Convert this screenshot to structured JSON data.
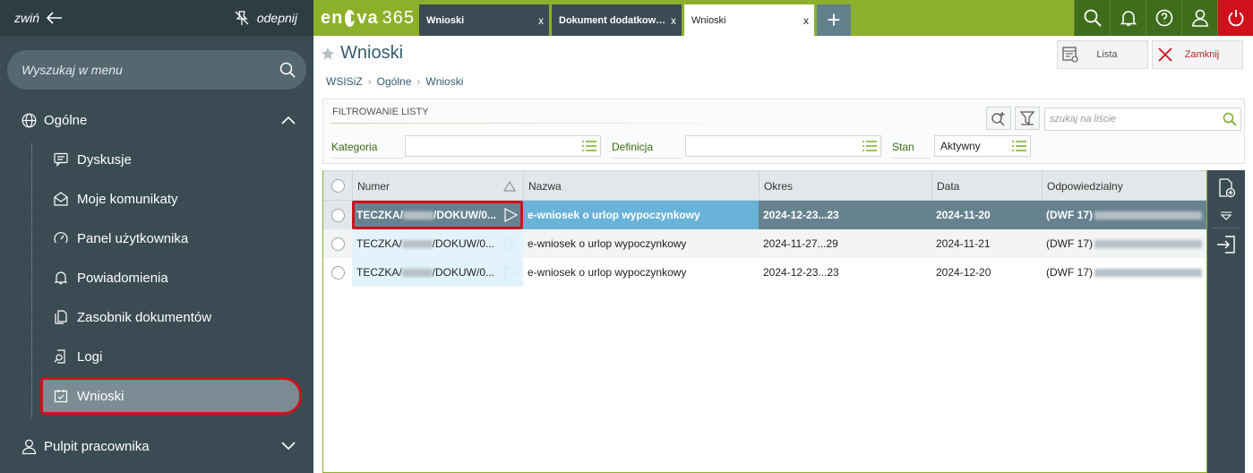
{
  "sidebar": {
    "collapse_label": "zwiń",
    "unpin_label": "odepnij",
    "search_placeholder": "Wyszukaj w menu",
    "section_general": "Ogólne",
    "items": [
      {
        "label": "Dyskusje",
        "icon": "chat-icon"
      },
      {
        "label": "Moje komunikaty",
        "icon": "envelope-icon"
      },
      {
        "label": "Panel użytkownika",
        "icon": "gauge-icon"
      },
      {
        "label": "Powiadomienia",
        "icon": "bell-icon"
      },
      {
        "label": "Zasobnik dokumentów",
        "icon": "documents-icon"
      },
      {
        "label": "Logi",
        "icon": "log-search-icon"
      },
      {
        "label": "Wnioski",
        "icon": "checklist-icon",
        "active": true
      }
    ],
    "section_employee": "Pulpit pracownika"
  },
  "topbar": {
    "logo_text": "en",
    "logo_text2": "va",
    "logo_num": "365",
    "tabs": [
      {
        "label": "Wnioski",
        "close": "x"
      },
      {
        "label": "Dokument dodatkow…",
        "close": "x"
      },
      {
        "label": "Wnioski",
        "close": "x",
        "active": true
      }
    ],
    "add_tab": "+"
  },
  "page": {
    "title": "Wnioski",
    "buttons": {
      "list": "Lista",
      "close": "Zamknij"
    },
    "breadcrumb": [
      "WSISiZ",
      "Ogólne",
      "Wnioski"
    ]
  },
  "filter": {
    "title": "FILTROWANIE LISTY",
    "search_placeholder": "szukaj na liście",
    "category_label": "Kategoria",
    "category_value": "",
    "definition_label": "Definicja",
    "definition_value": "",
    "status_label": "Stan",
    "status_value": "Aktywny"
  },
  "grid": {
    "columns": [
      "Numer",
      "Nazwa",
      "Okres",
      "Data",
      "Odpowiedzialny"
    ],
    "rows": [
      {
        "numer_a": "TECZKA/",
        "numer_b": "/DOKUW/0...",
        "nazwa": "e-wniosek o urlop wypoczynkowy",
        "okres": "2024-12-23...23",
        "data": "2024-11-20",
        "odp": "(DWF 17)"
      },
      {
        "numer_a": "TECZKA/",
        "numer_b": "/DOKUW/0...",
        "nazwa": "e-wniosek o urlop wypoczynkowy",
        "okres": "2024-11-27...29",
        "data": "2024-11-21",
        "odp": "(DWF 17)"
      },
      {
        "numer_a": "TECZKA/",
        "numer_b": "/DOKUW/0...",
        "nazwa": "e-wniosek o urlop wypoczynkowy",
        "okres": "2024-12-23...23",
        "data": "2024-12-20",
        "odp": "(DWF 17)"
      }
    ]
  },
  "colors": {
    "accent_green": "#8db02a",
    "sidebar": "#3b4b54",
    "highlight_red": "#d0111c",
    "selected_row": "#67828f"
  }
}
